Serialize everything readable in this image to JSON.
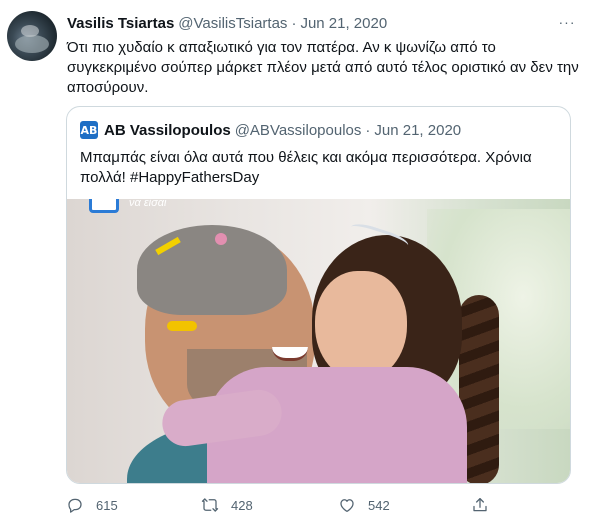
{
  "tweet": {
    "author_name": "Vasilis Tsiartas",
    "author_handle": "@VasilisTsiartas",
    "separator": "·",
    "date": "Jun 21, 2020",
    "more_label": "···",
    "text": "Ότι πιο χυδαίο κ απαξιωτικό για τον πατέρα. Αν κ ψωνίζω από το συγκεκριμένο σούπερ μάρκετ πλέον μετά από αυτό τέλος οριστικό αν δεν την αποσύρουν."
  },
  "quoted": {
    "logo_text": "AB",
    "author_name": "AB Vassilopoulos",
    "author_handle": "@ABVassilopoulos",
    "separator": "·",
    "date": "Jun 21, 2020",
    "text": "Μπαμπάς είναι όλα αυτά που θέλεις και ακόμα περισσότερα. Χρόνια πολλά! #HappyFathersDay",
    "photo_caption": "να είσαι"
  },
  "actions": {
    "replies": "615",
    "retweets": "428",
    "likes": "542"
  },
  "icons": [
    "reply-icon",
    "retweet-icon",
    "like-icon",
    "share-icon",
    "more-icon"
  ],
  "colors": {
    "text": "#0f1419",
    "secondary": "#536471",
    "border": "#cfd9de",
    "brand_blue": "#1f6fc5"
  }
}
